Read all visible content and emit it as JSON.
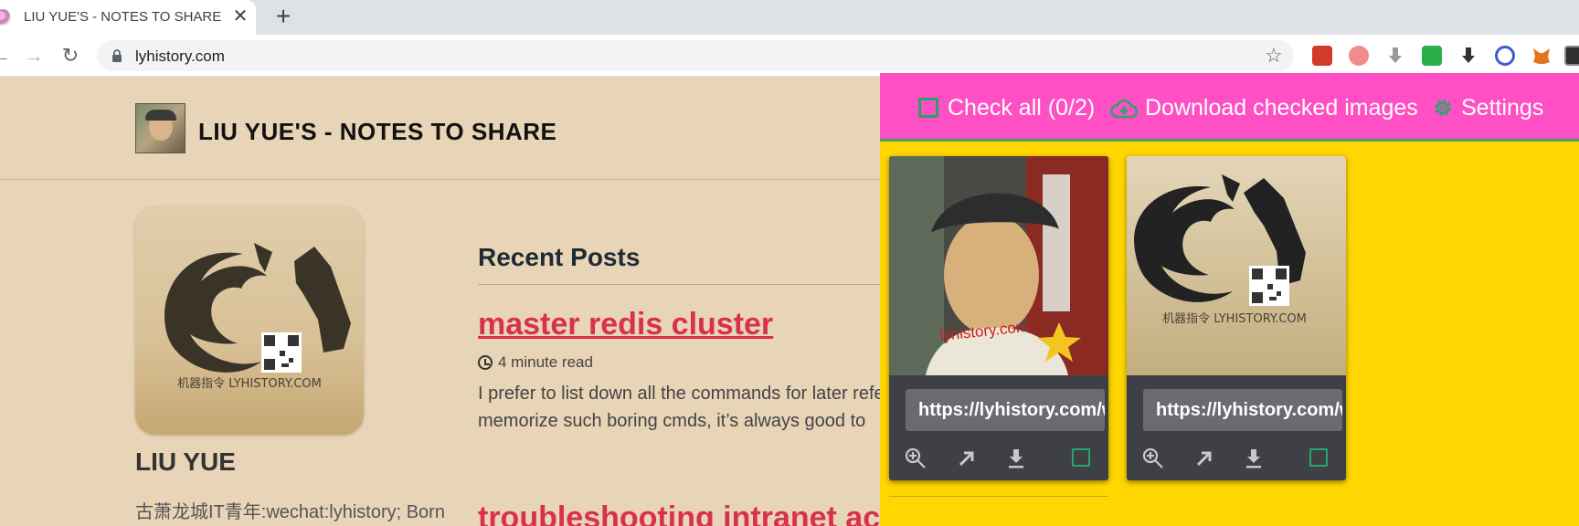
{
  "browser": {
    "tab_title": "LIU YUE'S - NOTES TO SHARE",
    "tab_close": "✕",
    "new_tab": "+",
    "url": "lyhistory.com"
  },
  "site": {
    "title": "LIU YUE'S - NOTES TO SHARE",
    "author_name": "LIU YUE",
    "author_bio": "古萧龙城IT青年:wechat:lyhistory; Born",
    "avatar_caption": "机器指令 LYHISTORY.COM"
  },
  "recent_posts": {
    "heading": "Recent Posts",
    "posts": [
      {
        "title": "master redis cluster",
        "read_time": "4 minute read",
        "excerpt_line1": "I prefer to list down all the commands for later reference",
        "excerpt_line2": "memorize such boring cmds, it’s always good to"
      },
      {
        "title": "troubleshooting intranet access"
      }
    ]
  },
  "extension": {
    "colors": {
      "header": "#ff4fc4",
      "panel": "#ffd600",
      "check": "#29a46c"
    },
    "check_all": "Check all (0/2)",
    "download_checked": "Download checked images",
    "settings": "Settings",
    "images": [
      {
        "url": "https://lyhistory.com/wp-content/uploads/profile.jpg",
        "watermark": "lyhistory.com",
        "checked": false
      },
      {
        "url": "https://lyhistory.com/wp-content/uploads/logo.jpg",
        "caption": "机器指令 LYHISTORY.COM",
        "checked": false
      }
    ]
  }
}
